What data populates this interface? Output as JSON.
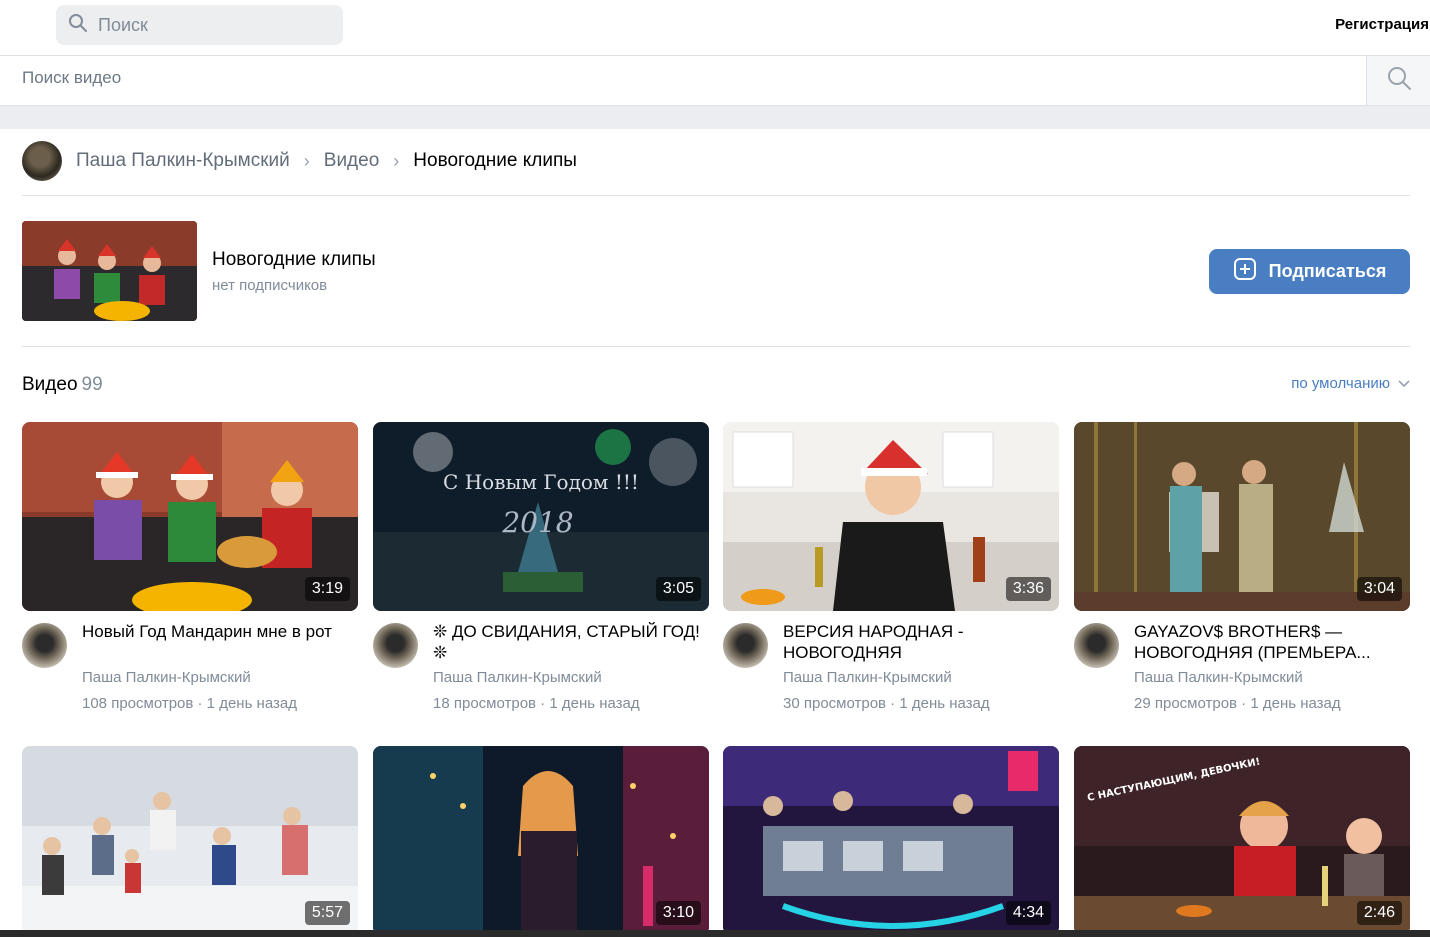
{
  "header": {
    "search_placeholder": "Поиск",
    "register_label": "Регистрация"
  },
  "video_search": {
    "placeholder": "Поиск видео"
  },
  "breadcrumb": {
    "owner": "Паша Палкин-Крымский",
    "section": "Видео",
    "current": "Новогодние клипы"
  },
  "album": {
    "title": "Новогодние клипы",
    "subtitle": "нет подписчиков",
    "subscribe_label": "Подписаться"
  },
  "videos_section": {
    "title": "Видео",
    "count": "99",
    "sort_label": "по умолчанию"
  },
  "videos": [
    {
      "title": "Новый Год Мандарин мне в рот",
      "author": "Паша Палкин-Крымский",
      "stats": "108 просмотров · 1 день назад",
      "duration": "3:19"
    },
    {
      "title": "❊ ДО СВИДАНИЯ, СТАРЫЙ ГОД! ❊",
      "author": "Паша Палкин-Крымский",
      "stats": "18 просмотров · 1 день назад",
      "duration": "3:05"
    },
    {
      "title": "ВЕРСИЯ НАРОДНАЯ - НОВОГОДНЯЯ",
      "author": "Паша Палкин-Крымский",
      "stats": "30 просмотров · 1 день назад",
      "duration": "3:36"
    },
    {
      "title": "GAYAZOV$ BROTHER$ — НОВОГОДНЯЯ (ПРЕМЬЕРА...",
      "author": "Паша Палкин-Крымский",
      "stats": "29 просмотров · 1 день назад",
      "duration": "3:04"
    },
    {
      "duration": "5:57"
    },
    {
      "duration": "3:10"
    },
    {
      "duration": "4:34"
    },
    {
      "duration": "2:46"
    }
  ],
  "thumb_text": {
    "v2_line1": "С Новым Годом !!!",
    "v2_line2": "2018",
    "v8_caption": "С НАСТУПАЮЩИМ, ДЕВОЧКИ!"
  },
  "colors": {
    "accent": "#4a7ec2",
    "muted": "#818c99",
    "divider": "#dce1e6"
  }
}
